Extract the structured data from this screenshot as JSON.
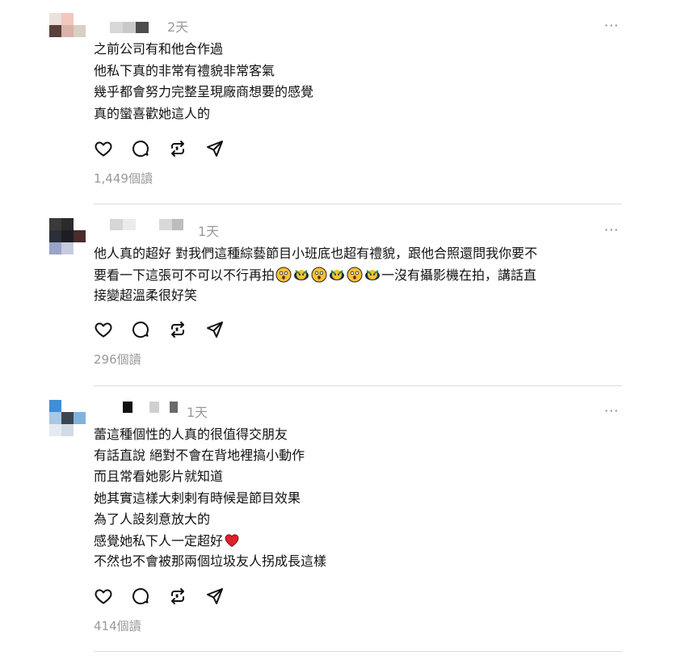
{
  "comments": [
    {
      "time": "2天",
      "lines": [
        "之前公司有和他合作過",
        "他私下真的非常有禮貌非常客氣",
        "幾乎都會努力完整呈現廠商想要的感覺",
        "真的蠻喜歡她這人的"
      ],
      "views": "1,449個讀"
    },
    {
      "time": "1天",
      "lines": [
        "他人真的超好 對我們這種綜藝節目小班底也超有禮貌，跟他合照還問我你要不",
        "要看一下這張可不可以不行再拍",
        "一沒有攝影機在拍，講話直",
        "接變超溫柔很好笑"
      ],
      "views": "296個讀"
    },
    {
      "time": "1天",
      "lines": [
        "蕾這種個性的人真的很值得交朋友",
        "有話直說 絕對不會在背地裡搞小動作",
        "而且常看她影片就知道",
        "她其實這樣大剌剌有時候是節目效果",
        "為了人設刻意放大的",
        "感覺她私下人一定超好",
        "不然也不會被那兩個垃圾友人拐成長這樣"
      ],
      "views": "414個讀"
    }
  ],
  "more_label": "···",
  "icons": [
    "heart-icon",
    "comment-icon",
    "repost-icon",
    "share-icon"
  ]
}
